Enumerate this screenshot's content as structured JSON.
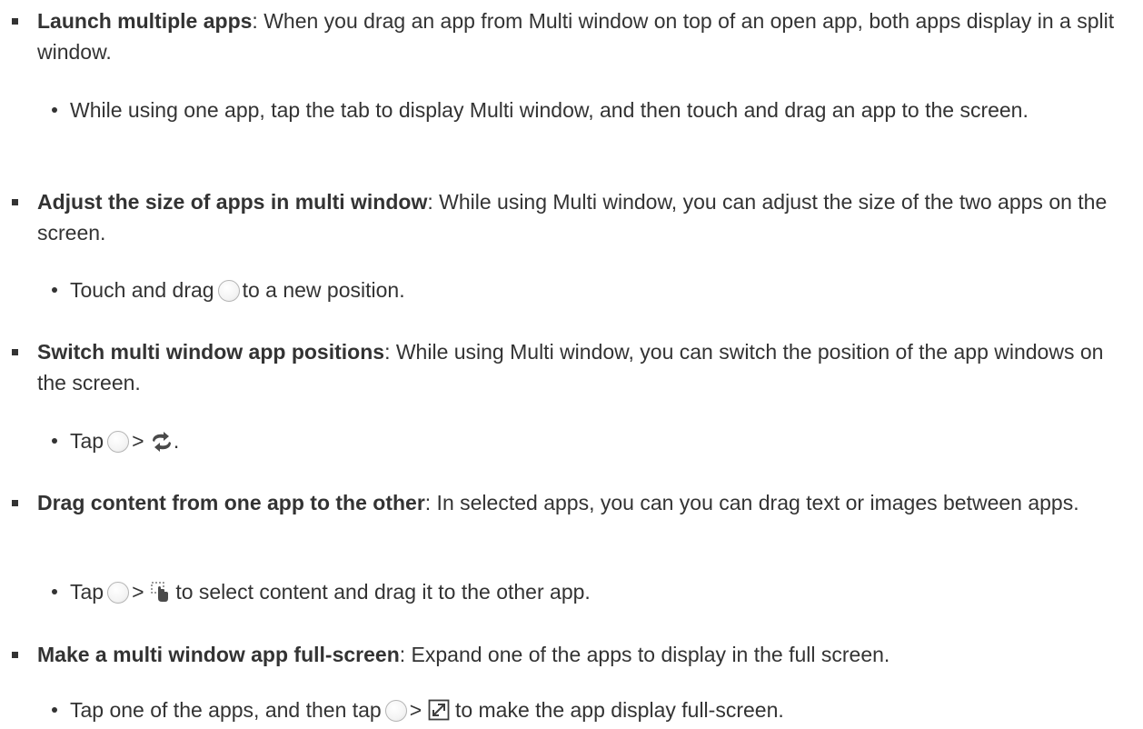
{
  "items": [
    {
      "bold": "Launch multiple apps",
      "text": ": When you drag an app from Multi window on top of an open app, both apps display in a split window.",
      "sub": "While using one app, tap the tab to display Multi window, and then touch and drag an app to the screen."
    },
    {
      "bold": "Adjust the size of apps in multi window",
      "text": ": While using Multi window, you can adjust the size of the two apps on the screen.",
      "sub_before": "Touch and drag",
      "sub_after": "to a new position."
    },
    {
      "bold": "Switch multi window app positions",
      "text": ": While using Multi window, you can switch the position of the app windows on the screen.",
      "sub_before": "Tap",
      "sub_sep": ">",
      "sub_after": "."
    },
    {
      "bold": "Drag content from one app to the other",
      "text": ": In selected apps, you can you can drag text or images between apps.",
      "sub_before": "Tap",
      "sub_sep": ">",
      "sub_after": "to select content and drag it to the other app."
    },
    {
      "bold": "Make a multi window app full-screen",
      "text": ": Expand one of the apps to display in the full screen.",
      "sub_before": "Tap one of the apps, and then tap",
      "sub_sep": ">",
      "sub_after": "to make the app display full-screen."
    }
  ],
  "icons": {
    "circle": "multi-window-circle-icon",
    "switch": "switch-windows-icon",
    "drag_content": "drag-content-icon",
    "full_screen": "full-screen-icon"
  },
  "colors": {
    "text": "#333333",
    "switch_icon": "#4a4a4a",
    "full_screen_icon": "#3d3d3d"
  }
}
